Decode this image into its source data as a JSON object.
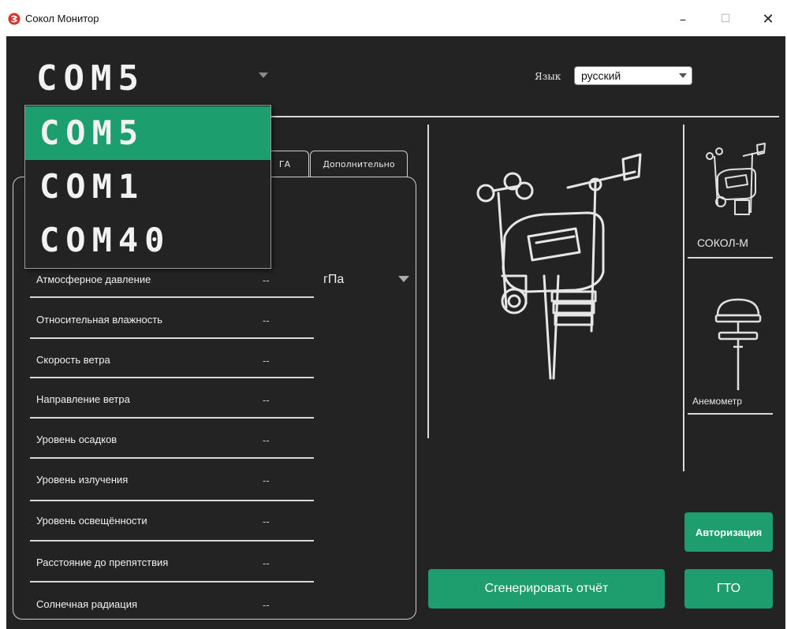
{
  "window": {
    "title": "Сокол Монитор",
    "minimize_label": "–",
    "maximize_label": "☐",
    "close_label": "✕"
  },
  "port": {
    "selected": "COM5",
    "options": [
      "COM5",
      "COM1",
      "COM40"
    ]
  },
  "language": {
    "label": "Язык",
    "value": "русский"
  },
  "tabs": [
    {
      "label": "ГА"
    },
    {
      "label": "Дополнительно"
    }
  ],
  "measurements": [
    {
      "label": "Атмосферное давление",
      "value": "--"
    },
    {
      "label": "Относительная влажность",
      "value": "--"
    },
    {
      "label": "Скорость ветра",
      "value": "--"
    },
    {
      "label": "Направление ветра",
      "value": "--"
    },
    {
      "label": "Уровень осадков",
      "value": "--"
    },
    {
      "label": "Уровень излучения",
      "value": "--"
    },
    {
      "label": "Уровень освещённости",
      "value": "--"
    },
    {
      "label": "Расстояние до препятствия",
      "value": "--"
    },
    {
      "label": "Солнечная радиация",
      "value": "--"
    }
  ],
  "unit": {
    "value": "гПа"
  },
  "devices": [
    {
      "label": "СОКОЛ-М",
      "icon": "weather-station-icon"
    },
    {
      "label": "Анемометр",
      "icon": "anemometer-icon"
    }
  ],
  "buttons": {
    "auth": "Авторизация",
    "report": "Сгенерировать отчёт",
    "gto": "ГТО"
  },
  "colors": {
    "accent": "#1e9e6e",
    "background": "#232323",
    "text": "#f0f0f0"
  }
}
